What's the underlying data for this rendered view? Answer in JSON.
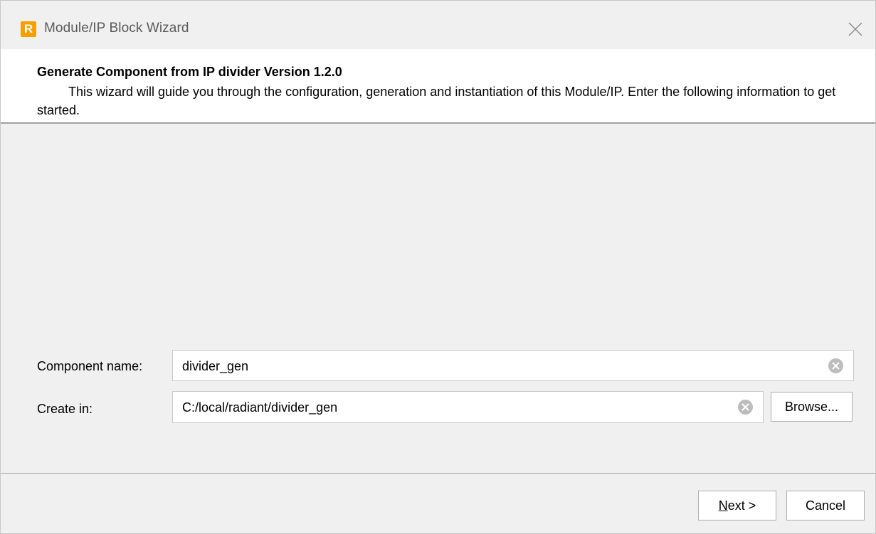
{
  "window": {
    "title": "Module/IP Block Wizard",
    "app_icon_letter": "R",
    "close_icon": "close-icon"
  },
  "header": {
    "title": "Generate Component from IP divider Version 1.2.0",
    "description": "This wizard will guide you through the configuration, generation and instantiation of this Module/IP. Enter the following information to get started."
  },
  "form": {
    "component_name_label": "Component name:",
    "component_name_value": "divider_gen",
    "create_in_label": "Create in:",
    "create_in_value": "C:/local/radiant/divider_gen",
    "browse_label": "Browse..."
  },
  "footer": {
    "next_mnemonic": "N",
    "next_rest": "ext >",
    "cancel_label": "Cancel"
  },
  "colors": {
    "app_icon": "#f5a000",
    "header_bg": "#ffffff",
    "window_bg": "#f0f0f0"
  }
}
